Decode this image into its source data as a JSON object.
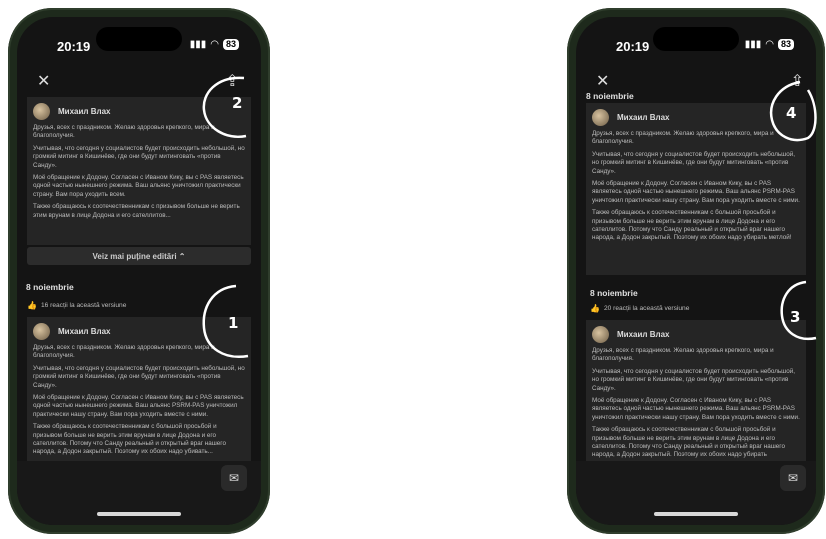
{
  "phones": [
    {
      "time": "20:19",
      "battery": "83",
      "show_more_label": "Veiz mai puține editări ⌃",
      "date": "8 noiembrie",
      "reactions": "16 reacții la această versiune",
      "card_top": {
        "author": "Михаил Влах",
        "paragraphs": [
          "Друзья, всех с праздником. Желаю здоровья крепкого, мира и благополучия.",
          "Учитывая, что сегодня у социалистов будет происходить небольшой, но громкий митинг в Кишинёве, где они будут митинговать «против Санду».",
          "Моё обращение к Додону. Согласен с Иваном Кику, вы с PAS являетесь одной частью нынешнего режима. Ваш альянс уничтожил практически страну. Вам пора уходить всем.",
          "Также обращаюсь к соотечественникам с призывом больше не верить этим врунам в лице Додона и его сателлитов..."
        ]
      },
      "card_bottom": {
        "author": "Михаил Влах",
        "paragraphs": [
          "Друзья, всех с праздником. Желаю здоровья крепкого, мира и благополучия.",
          "Учитывая, что сегодня у социалистов будет происходить небольшой, но громкий митинг в Кишинёве, где они будут митинговать «против Санду».",
          "Моё обращение к Додону. Согласен с Иваном Кику, вы с PAS являетесь одной частью нынешнего режима. Ваш альянс PSRM-PAS уничтожил практически нашу страну. Вам пора уходить вместе с ними.",
          "Также обращаюсь к соотечественникам с большой просьбой и призывом больше не верить этим врунам в лице Додона и его сателлитов. Потому что Санду реальный и открытый враг нашего народа, а Додон закрытый. Поэтому их обоих надо убивать..."
        ]
      },
      "annotations": [
        "2",
        "1"
      ]
    },
    {
      "time": "20:19",
      "battery": "83",
      "date_top": "8 noiembrie",
      "date": "8 noiembrie",
      "reactions": "20 reacții la această versiune",
      "card_top": {
        "author": "Михаил Влах",
        "paragraphs": [
          "Друзья, всех с праздником. Желаю здоровья крепкого, мира и благополучия.",
          "Учитывая, что сегодня у социалистов будет происходить небольшой, но громкий митинг в Кишинёве, где они будут митинговать «против Санду».",
          "Моё обращение к Додону. Согласен с Иваном Кику, вы с PAS являетесь одной частью нынешнего режима. Ваш альянс PSRM-PAS уничтожил практически нашу страну. Вам пора уходить вместе с ними.",
          "Также обращаюсь к соотечественникам с большой просьбой и призывом больше не верить этим врунам в лице Додона и его сателлитов. Потому что Санду реальный и открытый враг нашего народа, а Додон закрытый. Поэтому их обоих надо убирать метлой!"
        ]
      },
      "card_bottom": {
        "author": "Михаил Влах",
        "paragraphs": [
          "Друзья, всех с праздником. Желаю здоровья крепкого, мира и благополучия.",
          "Учитывая, что сегодня у социалистов будет происходить небольшой, но громкий митинг в Кишинёве, где они будут митинговать «против Санду».",
          "Моё обращение к Додону. Согласен с Иваном Кику, вы с PAS являетесь одной частью нынешнего режима. Ваш альянс PSRM-PAS уничтожил практически нашу страну. Вам пора уходить вместе с ними.",
          "Также обращаюсь к соотечественникам с большой просьбой и призывом больше не верить этим врунам в лице Додона и его сателлитов. Потому что Санду реальный и открытый враг нашего народа, а Додон закрытый. Поэтому их обоих надо убирать"
        ]
      },
      "annotations": [
        "4",
        "3"
      ]
    }
  ],
  "icons": {
    "close": "close-icon",
    "share": "share-icon",
    "signal": "signal-icon",
    "wifi": "wifi-icon",
    "like": "thumbs-up-icon",
    "message": "message-icon"
  },
  "colors": {
    "background": "#ffffff",
    "phone_frame": "#1e2a1c",
    "screen": "#141414",
    "card": "#252525",
    "annotation": "#ffffff"
  }
}
